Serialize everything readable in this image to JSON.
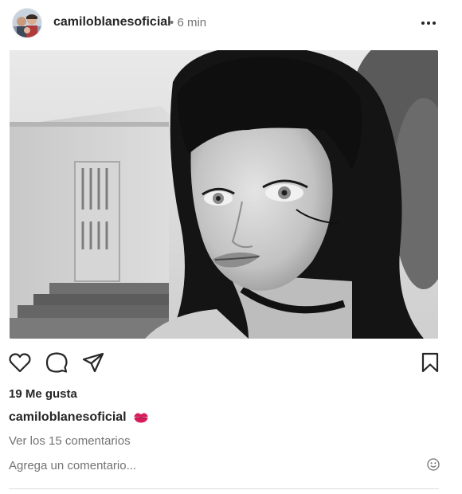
{
  "post": {
    "username": "camiloblanesoficial",
    "separator": "•",
    "time_ago": "6 min"
  },
  "image": {
    "description_icon": "portrait-photo"
  },
  "actions": {
    "like_icon": "heart-icon",
    "comment_icon": "comment-icon",
    "share_icon": "share-icon",
    "save_icon": "bookmark-icon"
  },
  "likes_text": "19 Me gusta",
  "caption": {
    "username": "camiloblanesoficial",
    "emoji": "💋"
  },
  "view_comments": "Ver los 15 comentarios",
  "comment_input": {
    "placeholder": "Agrega un comentario..."
  },
  "colors": {
    "text_primary": "#262626",
    "text_secondary": "#737373",
    "divider": "#dbdbdb",
    "kiss": "#d81b5c"
  }
}
